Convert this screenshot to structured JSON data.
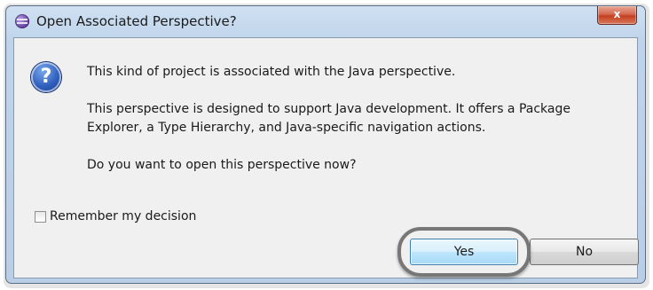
{
  "window": {
    "title": "Open Associated Perspective?",
    "close_label": "x"
  },
  "dialog": {
    "icon": "question-icon",
    "icon_glyph": "?",
    "message_line1": "This kind of project is associated with the Java perspective.",
    "message_line2": "This perspective is designed to support Java development. It offers a Package Explorer, a Type Hierarchy, and Java-specific navigation actions.",
    "message_line3": "Do you want to open this perspective now?",
    "remember_label": "Remember my decision",
    "remember_checked": false,
    "yes_label": "Yes",
    "no_label": "No"
  },
  "colors": {
    "title_bar": "#bfd4ea",
    "close_button": "#c4401f",
    "client_background": "#f0f0f0",
    "default_button_border": "#3c7fb1",
    "highlight_ring": "#777777"
  }
}
